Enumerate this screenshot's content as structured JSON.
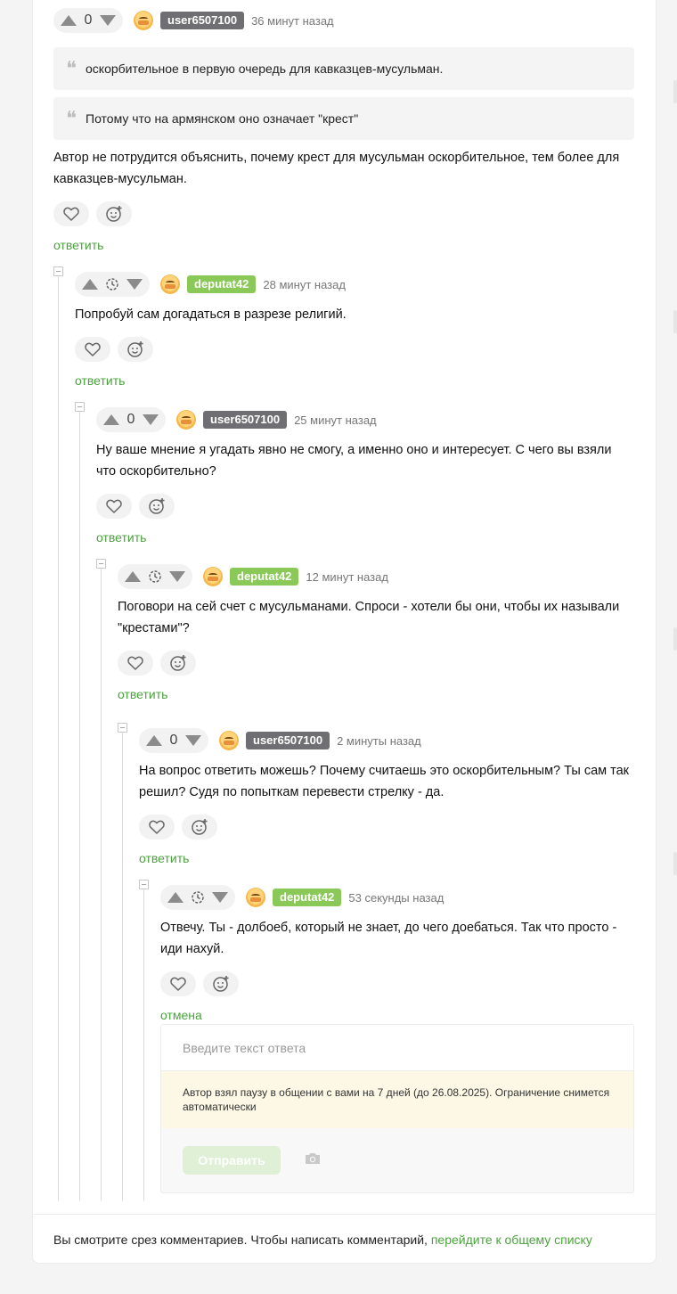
{
  "colors": {
    "accent_green": "#4aa33c",
    "badge_green": "#8ac858",
    "badge_gray": "#6f6f73"
  },
  "comments": [
    {
      "vote": "0",
      "user": "user6507100",
      "time": "36 минут назад",
      "quotes": [
        "оскорбительное в первую очередь для кавказцев-мусульман.",
        "Потому что на армянском оно означает \"крест\""
      ],
      "text": "Автор не потрудится объяснить, почему крест для мусульман оскорбительное, тем более для кавказцев-мусульман.",
      "reply": "ответить"
    },
    {
      "vote": "",
      "user": "deputat42",
      "time": "28 минут назад",
      "text": "Попробуй сам догадаться в разрезе религий.",
      "reply": "ответить"
    },
    {
      "vote": "0",
      "user": "user6507100",
      "time": "25 минут назад",
      "text": "Ну ваше мнение я угадать явно не смогу, а именно оно и интересует. С чего вы взяли что оскорбительно?",
      "reply": "ответить"
    },
    {
      "vote": "",
      "user": "deputat42",
      "time": "12 минут назад",
      "text": "Поговори на сей счет с мусульманами. Спроси - хотели бы они, чтобы их называли \"крестами\"?",
      "reply": "ответить"
    },
    {
      "vote": "0",
      "user": "user6507100",
      "time": "2 минуты назад",
      "text": "На вопрос ответить можешь? Почему считаешь это оскорбительным? Ты сам так решил? Судя по попыткам перевести стрелку - да.",
      "reply": "ответить"
    },
    {
      "vote": "",
      "user": "deputat42",
      "time": "53 секунды назад",
      "text": "Отвечу. Ты - долбоеб, который не знает, до чего доебаться. Так что просто - иди нахуй.",
      "reply": "отмена"
    }
  ],
  "reply_form": {
    "placeholder": "Введите текст ответа",
    "warning": "Автор взял паузу в общении с вами на 7 дней (до 26.08.2025). Ограничение снимется автоматически",
    "send_label": "Отправить"
  },
  "footer": {
    "text": "Вы смотрите срез комментариев. Чтобы написать комментарий, ",
    "link": "перейдите к общему списку"
  }
}
